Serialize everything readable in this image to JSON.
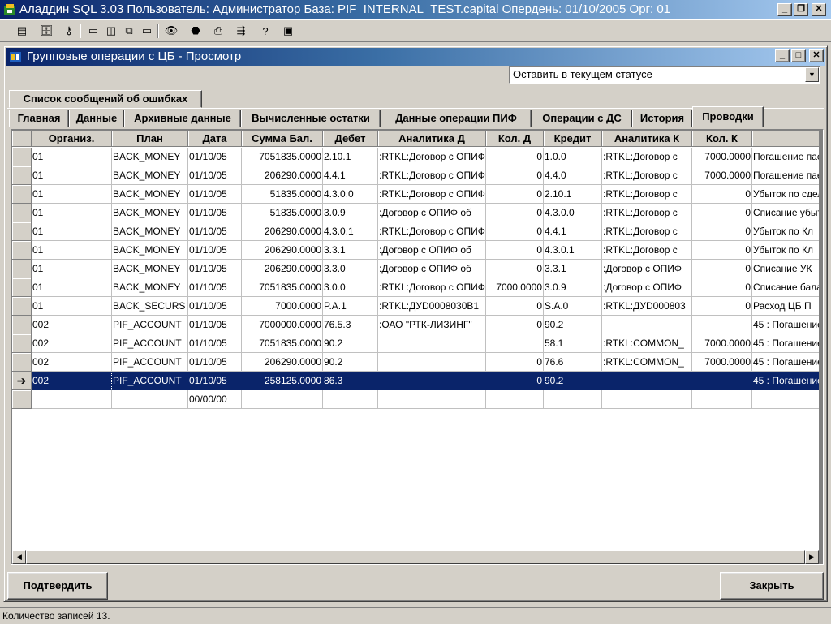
{
  "app": {
    "title": "Аладдин SQL 3.03 Пользователь: Администратор База: PIF_INTERNAL_TEST.capital Опердень: 01/10/2005 Орг: 01"
  },
  "child_window": {
    "title": "Групповые операции с ЦБ - Просмотр",
    "status_select_value": "Оставить в текущем статусе"
  },
  "tabs_row1": [
    {
      "label": "Список сообщений об ошибках"
    }
  ],
  "tabs_row2": [
    {
      "label": "Главная"
    },
    {
      "label": "Данные"
    },
    {
      "label": "Архивные данные"
    },
    {
      "label": "Вычисленные остатки"
    },
    {
      "label": "Данные операции ПИФ"
    },
    {
      "label": "Операции с ДС"
    },
    {
      "label": "История"
    },
    {
      "label": "Проводки"
    }
  ],
  "active_tab": "Проводки",
  "grid": {
    "columns": [
      "Организ.",
      "План",
      "Дата",
      "Сумма Бал.",
      "Дебет",
      "Аналитика Д",
      "Кол. Д",
      "Кредит",
      "Аналитика К",
      "Кол. К",
      ""
    ],
    "rows": [
      [
        "01",
        "BACK_MONEY",
        "01/10/05",
        "7051835.0000",
        "2.10.1",
        ":RTKL:Договор с ОПИФ",
        "0",
        "1.0.0",
        ":RTKL:Договор с",
        "7000.0000",
        "Погашение паев"
      ],
      [
        "01",
        "BACK_MONEY",
        "01/10/05",
        "206290.0000",
        "4.4.1",
        ":RTKL:Договор с ОПИФ",
        "0",
        "4.4.0",
        ":RTKL:Договор с",
        "7000.0000",
        "Погашение паев"
      ],
      [
        "01",
        "BACK_MONEY",
        "01/10/05",
        "51835.0000",
        "4.3.0.0",
        ":RTKL:Договор с ОПИФ",
        "0",
        "2.10.1",
        ":RTKL:Договор с",
        "0",
        "Убыток по сделке"
      ],
      [
        "01",
        "BACK_MONEY",
        "01/10/05",
        "51835.0000",
        "3.0.9",
        ":Договор с ОПИФ об",
        "0",
        "4.3.0.0",
        ":RTKL:Договор с",
        "0",
        "Списание убытка"
      ],
      [
        "01",
        "BACK_MONEY",
        "01/10/05",
        "206290.0000",
        "4.3.0.1",
        ":RTKL:Договор с ОПИФ",
        "0",
        "4.4.1",
        ":RTKL:Договор с",
        "0",
        "Убыток по Кл"
      ],
      [
        "01",
        "BACK_MONEY",
        "01/10/05",
        "206290.0000",
        "3.3.1",
        ":Договор с ОПИФ об",
        "0",
        "4.3.0.1",
        ":RTKL:Договор с",
        "0",
        "Убыток по Кл"
      ],
      [
        "01",
        "BACK_MONEY",
        "01/10/05",
        "206290.0000",
        "3.3.0",
        ":Договор с ОПИФ об",
        "0",
        "3.3.1",
        ":Договор с ОПИФ",
        "0",
        "Списание УК"
      ],
      [
        "01",
        "BACK_MONEY",
        "01/10/05",
        "7051835.0000",
        "3.0.0",
        ":RTKL:Договор с ОПИФ",
        "7000.0000",
        "3.0.9",
        ":Договор с ОПИФ",
        "0",
        "Списание баланс"
      ],
      [
        "01",
        "BACK_SECURS",
        "01/10/05",
        "7000.0000",
        "P.A.1",
        ":RTKL:ДУD0008030B1",
        "0",
        "S.A.0",
        ":RTKL:ДУD000803",
        "0",
        "Расход ЦБ П"
      ],
      [
        "002",
        "PIF_ACCOUNT",
        "01/10/05",
        "7000000.0000",
        "76.5.3",
        ":ОАО \"РТК-ЛИЗИНГ\"",
        "0",
        "90.2",
        "",
        "",
        "45 : Погашение"
      ],
      [
        "002",
        "PIF_ACCOUNT",
        "01/10/05",
        "7051835.0000",
        "90.2",
        "",
        "",
        "58.1",
        ":RTKL:COMMON_",
        "7000.0000",
        "45 : Погашение"
      ],
      [
        "002",
        "PIF_ACCOUNT",
        "01/10/05",
        "206290.0000",
        "90.2",
        "",
        "0",
        "76.6",
        ":RTKL:COMMON_",
        "7000.0000",
        "45 : Погашение"
      ],
      [
        "002",
        "PIF_ACCOUNT",
        "01/10/05",
        "258125.0000",
        "86.3",
        "",
        "0",
        "90.2",
        "",
        "",
        "45 : Погашение"
      ]
    ],
    "new_row_date": "00/00/00",
    "selected_row": 12
  },
  "buttons": {
    "confirm": "Подтвердить",
    "close": "Закрыть"
  },
  "status_bar": "Количество записей 13."
}
